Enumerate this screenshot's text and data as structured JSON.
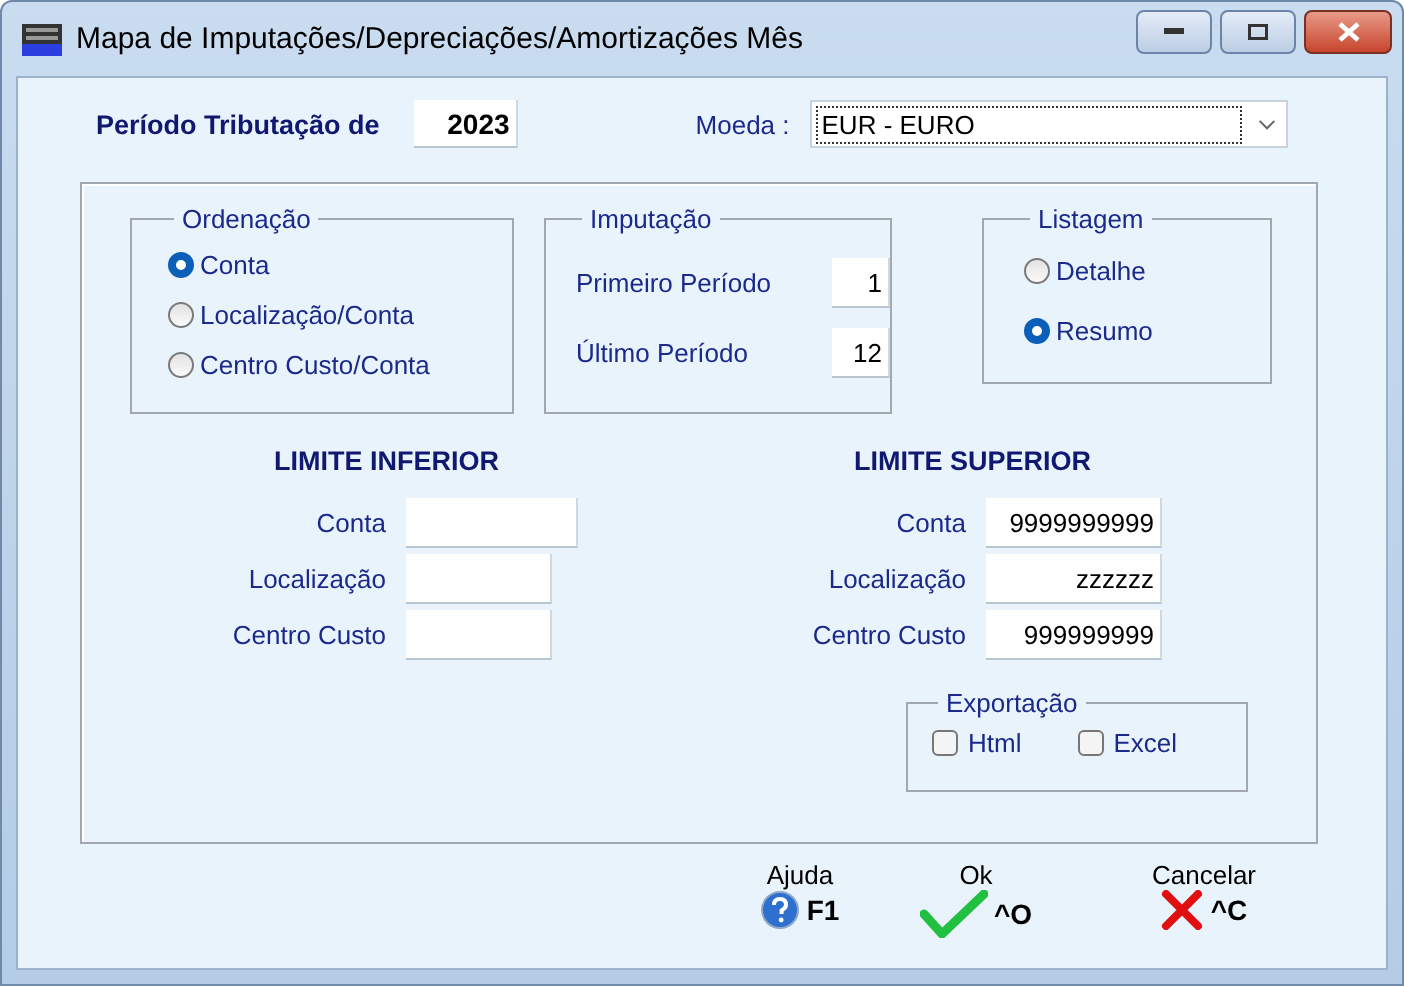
{
  "window": {
    "title": "Mapa de Imputações/Depreciações/Amortizações Mês"
  },
  "period": {
    "label": "Período Tributação de",
    "value": "2023"
  },
  "currency": {
    "label": "Moeda :",
    "value": "EUR - EURO"
  },
  "ordering": {
    "legend": "Ordenação",
    "options": [
      {
        "label": "Conta",
        "selected": true
      },
      {
        "label": "Localização/Conta",
        "selected": false
      },
      {
        "label": "Centro Custo/Conta",
        "selected": false
      }
    ]
  },
  "imputation": {
    "legend": "Imputação",
    "fields": [
      {
        "label": "Primeiro Período",
        "value": "1"
      },
      {
        "label": "Último Período",
        "value": "12"
      }
    ]
  },
  "listing": {
    "legend": "Listagem",
    "options": [
      {
        "label": "Detalhe",
        "selected": false
      },
      {
        "label": "Resumo",
        "selected": true
      }
    ]
  },
  "lower_limit": {
    "heading": "LIMITE INFERIOR",
    "fields": [
      {
        "label": "Conta"
      },
      {
        "label": "Localização"
      },
      {
        "label": "Centro Custo"
      }
    ]
  },
  "upper_limit": {
    "heading": "LIMITE SUPERIOR",
    "fields": [
      {
        "label": "Conta",
        "value": "9999999999"
      },
      {
        "label": "Localização",
        "value": "zzzzzz"
      },
      {
        "label": "Centro Custo",
        "value": "999999999"
      }
    ]
  },
  "export": {
    "legend": "Exportação",
    "options": [
      {
        "label": "Html",
        "checked": false
      },
      {
        "label": "Excel",
        "checked": false
      }
    ]
  },
  "buttons": [
    {
      "label": "Ajuda",
      "shortcut": "F1",
      "kind": "help"
    },
    {
      "label": "Ok",
      "shortcut": "^O",
      "kind": "ok"
    },
    {
      "label": "Cancelar",
      "shortcut": "^C",
      "kind": "cancel"
    }
  ]
}
